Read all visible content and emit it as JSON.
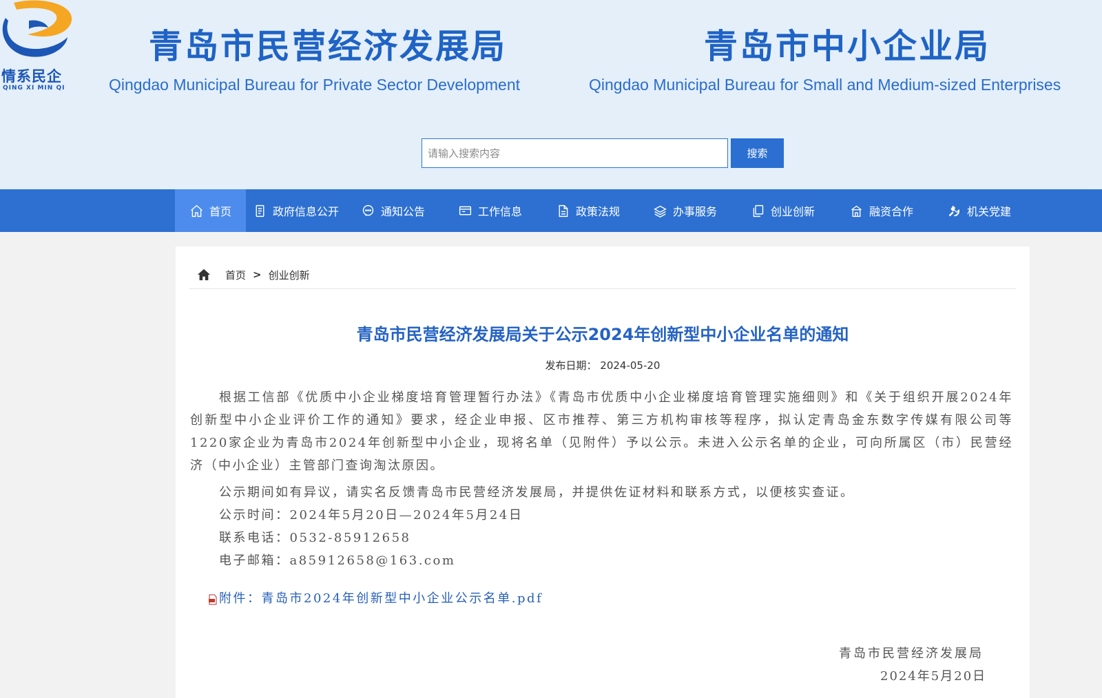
{
  "header": {
    "logo_text": "情系民企",
    "logo_pinyin": "QING XI MIN QI",
    "bureau_left_cn": "青岛市民营经济发展局",
    "bureau_left_en": "Qingdao Municipal Bureau for Private Sector Development",
    "bureau_right_cn": "青岛市中小企业局",
    "bureau_right_en": "Qingdao Municipal Bureau for Small and Medium-sized Enterprises"
  },
  "search": {
    "placeholder": "请输入搜索内容",
    "button": "搜索"
  },
  "nav": [
    {
      "label": "首页",
      "icon": "home-icon",
      "active": true
    },
    {
      "label": "政府信息公开",
      "icon": "document-icon"
    },
    {
      "label": "通知公告",
      "icon": "chat-icon"
    },
    {
      "label": "工作信息",
      "icon": "monitor-icon"
    },
    {
      "label": "政策法规",
      "icon": "file-icon"
    },
    {
      "label": "办事服务",
      "icon": "layers-icon"
    },
    {
      "label": "创业创新",
      "icon": "copy-icon"
    },
    {
      "label": "融资合作",
      "icon": "building-icon"
    },
    {
      "label": "机关党建",
      "icon": "party-emblem-icon"
    }
  ],
  "breadcrumb": {
    "home": "首页",
    "separator": ">",
    "current": "创业创新"
  },
  "article": {
    "title": "青岛市民营经济发展局关于公示2024年创新型中小企业名单的通知",
    "date_label": "发布日期：",
    "date_value": "2024-05-20",
    "paragraph1": "根据工信部《优质中小企业梯度培育管理暂行办法》《青岛市优质中小企业梯度培育管理实施细则》和《关于组织开展2024年创新型中小企业评价工作的通知》要求，经企业申报、区市推荐、第三方机构审核等程序，拟认定青岛金东数字传媒有限公司等1220家企业为青岛市2024年创新型中小企业，现将名单（见附件）予以公示。未进入公示名单的企业，可向所属区（市）民营经济（中小企业）主管部门查询淘汰原因。",
    "paragraph2": "公示期间如有异议，请实名反馈青岛市民营经济发展局，并提供佐证材料和联系方式，以便核实查证。",
    "period": "公示时间：2024年5月20日—2024年5月24日",
    "phone": "联系电话：0532-85912658",
    "email": "电子邮箱：a85912658@163.com",
    "attachment": "附件：青岛市2024年创新型中小企业公示名单.pdf",
    "signature_org": "青岛市民营经济发展局",
    "signature_date": "2024年5月20日"
  },
  "colors": {
    "brand_blue": "#2d70d1",
    "header_bg": "#e4effa",
    "title_blue": "#1f63c5",
    "logo_orange": "#f5a623"
  }
}
